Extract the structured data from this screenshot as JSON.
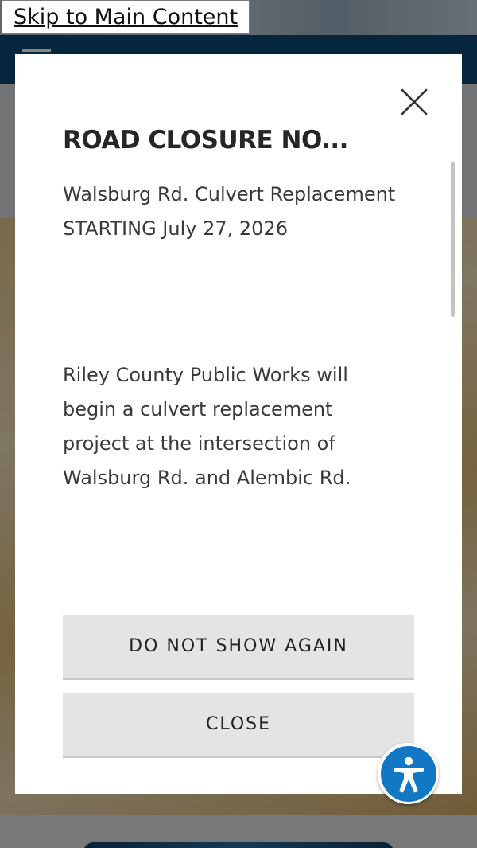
{
  "skip_link": {
    "label": "Skip to Main Content"
  },
  "modal": {
    "title": "ROAD CLOSURE NO...",
    "close_icon": "close-icon",
    "body": {
      "headline": "Walsburg Rd. Culvert Replacement STARTING July 27, 2026",
      "paragraph": "Riley County Public Works will begin a culvert replacement project at the intersection of Walsburg Rd. and Alembic Rd."
    },
    "buttons": {
      "do_not_show_again": "DO NOT SHOW AGAIN",
      "close": "CLOSE"
    }
  },
  "accessibility_widget": {
    "icon": "accessibility-icon"
  },
  "colors": {
    "nav_bar": "#0b4a74",
    "accessibility_blue": "#1378c4",
    "button_bg": "#e4e4e4",
    "modal_bg": "#ffffff"
  }
}
